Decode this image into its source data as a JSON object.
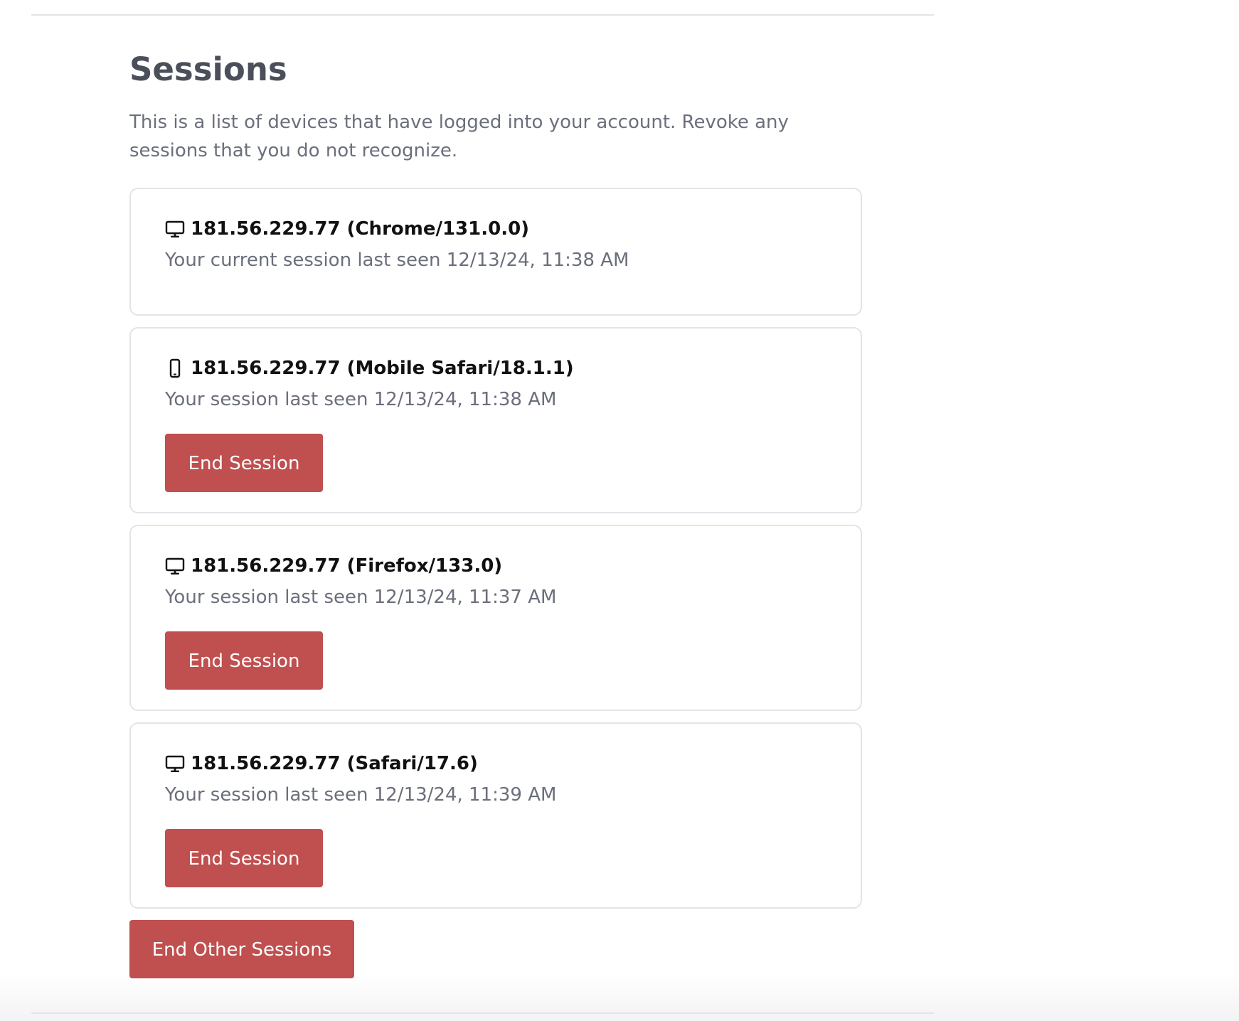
{
  "section": {
    "title": "Sessions",
    "description": "This is a list of devices that have logged into your account. Revoke any sessions that you do not recognize."
  },
  "sessions": [
    {
      "device": "181.56.229.77 (Chrome/131.0.0)",
      "last_seen": "Your current session last seen 12/13/24, 11:38 AM",
      "icon": "desktop-icon",
      "current": true
    },
    {
      "device": "181.56.229.77 (Mobile Safari/18.1.1)",
      "last_seen": "Your session last seen 12/13/24, 11:38 AM",
      "icon": "mobile-icon",
      "button_label": "End Session"
    },
    {
      "device": "181.56.229.77 (Firefox/133.0)",
      "last_seen": "Your session last seen 12/13/24, 11:37 AM",
      "icon": "desktop-icon",
      "button_label": "End Session"
    },
    {
      "device": "181.56.229.77 (Safari/17.6)",
      "last_seen": "Your session last seen 12/13/24, 11:39 AM",
      "icon": "desktop-icon",
      "button_label": "End Session"
    }
  ],
  "end_other_label": "End Other Sessions",
  "colors": {
    "danger": "#c04f4f",
    "title": "#4a4f5a",
    "muted": "#6b6f7c",
    "border": "#e3e4e8"
  }
}
